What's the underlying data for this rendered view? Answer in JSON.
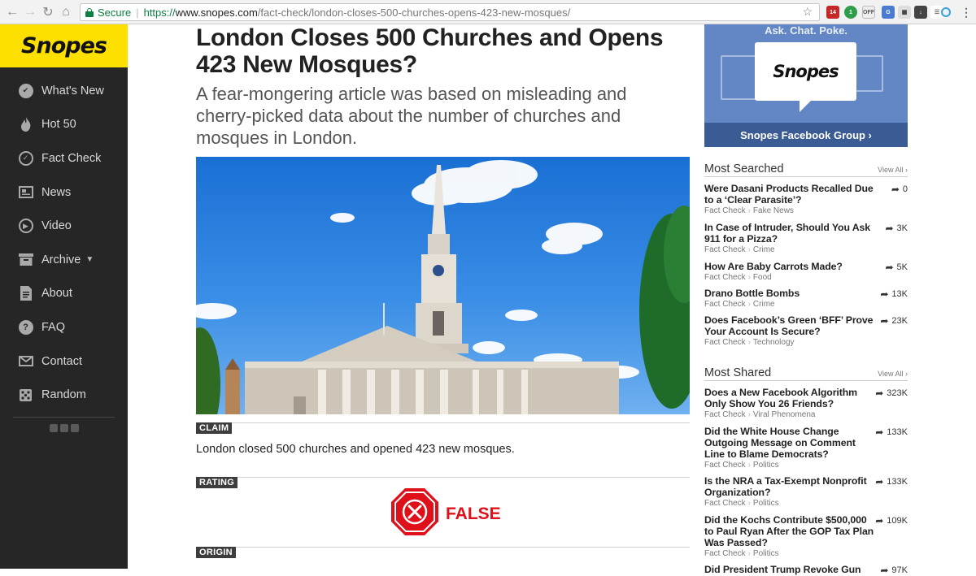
{
  "browser": {
    "secure_label": "Secure",
    "url_scheme": "https://",
    "url_host": "www.snopes.com",
    "url_path": "/fact-check/london-closes-500-churches-opens-423-new-mosques/",
    "ext_badge_1": "14",
    "ext_badge_2": "1",
    "ext_label_3": "OFF"
  },
  "sidebar": {
    "logo": "Snopes",
    "items": [
      {
        "label": "What's New",
        "icon": "whats-new-icon"
      },
      {
        "label": "Hot 50",
        "icon": "flame-icon"
      },
      {
        "label": "Fact Check",
        "icon": "check-circle-icon"
      },
      {
        "label": "News",
        "icon": "news-icon"
      },
      {
        "label": "Video",
        "icon": "play-icon"
      },
      {
        "label": "Archive",
        "icon": "archive-icon"
      },
      {
        "label": "About",
        "icon": "document-icon"
      },
      {
        "label": "FAQ",
        "icon": "question-icon"
      },
      {
        "label": "Contact",
        "icon": "envelope-icon"
      },
      {
        "label": "Random",
        "icon": "dice-icon"
      }
    ]
  },
  "article": {
    "title": "London Closes 500 Churches and Opens 423 New Mosques?",
    "subtitle": "A fear-mongering article was based on misleading and cherry-picked data about the number of churches and mosques in London.",
    "claim_label": "CLAIM",
    "claim_text": "London closed 500 churches and opened 423 new mosques.",
    "rating_label": "RATING",
    "rating_value": "FALSE",
    "origin_label": "ORIGIN"
  },
  "promo": {
    "tagline": "Ask. Chat. Poke.",
    "logo": "Snopes",
    "cta": "Snopes Facebook Group ›"
  },
  "most_searched": {
    "heading": "Most Searched",
    "view_all": "View All ›",
    "items": [
      {
        "title": "Were Dasani Products Recalled Due to a ‘Clear Parasite’?",
        "section": "Fact Check",
        "category": "Fake News",
        "shares": "0"
      },
      {
        "title": "In Case of Intruder, Should You Ask 911 for a Pizza?",
        "section": "Fact Check",
        "category": "Crime",
        "shares": "3K"
      },
      {
        "title": "How Are Baby Carrots Made?",
        "section": "Fact Check",
        "category": "Food",
        "shares": "5K"
      },
      {
        "title": "Drano Bottle Bombs",
        "section": "Fact Check",
        "category": "Crime",
        "shares": "13K"
      },
      {
        "title": "Does Facebook’s Green ‘BFF’ Prove Your Account Is Secure?",
        "section": "Fact Check",
        "category": "Technology",
        "shares": "23K"
      }
    ]
  },
  "most_shared": {
    "heading": "Most Shared",
    "view_all": "View All ›",
    "items": [
      {
        "title": "Does a New Facebook Algorithm Only Show You 26 Friends?",
        "section": "Fact Check",
        "category": "Viral Phenomena",
        "shares": "323K"
      },
      {
        "title": "Did the White House Change Outgoing Message on Comment Line to Blame Democrats?",
        "section": "Fact Check",
        "category": "Politics",
        "shares": "133K"
      },
      {
        "title": "Is the NRA a Tax-Exempt Nonprofit Organization?",
        "section": "Fact Check",
        "category": "Politics",
        "shares": "133K"
      },
      {
        "title": "Did the Kochs Contribute $500,000 to Paul Ryan After the GOP Tax Plan Was Passed?",
        "section": "Fact Check",
        "category": "Politics",
        "shares": "109K"
      },
      {
        "title": "Did President Trump Revoke Gun",
        "section": "",
        "category": "",
        "shares": "97K"
      }
    ]
  }
}
